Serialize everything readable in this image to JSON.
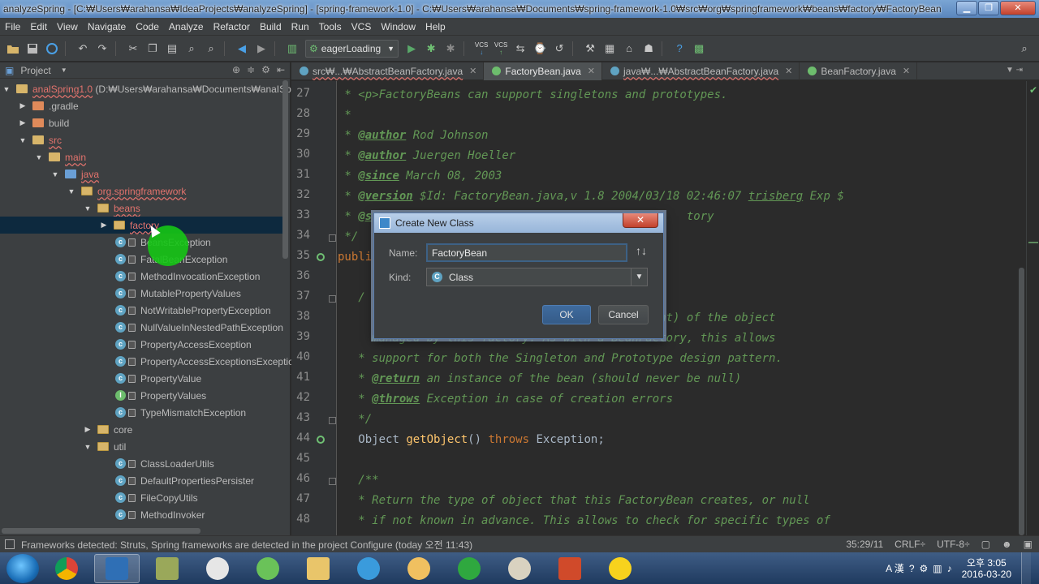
{
  "window": {
    "title": "analyzeSpring - [C:₩Users₩arahansa₩IdeaProjects₩analyzeSpring] - [spring-framework-1.0] - C:₩Users₩arahansa₩Documents₩spring-framework-1.0₩src₩org₩springframework₩beans₩factory₩FactoryBean.java...",
    "minimize": "▁",
    "maximize": "❐",
    "close": "✕"
  },
  "menu": [
    "File",
    "Edit",
    "View",
    "Navigate",
    "Code",
    "Analyze",
    "Refactor",
    "Build",
    "Run",
    "Tools",
    "VCS",
    "Window",
    "Help"
  ],
  "toolbar": {
    "run_config": "eagerLoading",
    "vcs1": "VCS",
    "vcs2": "VCS"
  },
  "project": {
    "header": "Project",
    "tree": [
      {
        "label": "analSpring1.0",
        "extra": "(D:₩Users₩arahansa₩Documents₩anaISpr",
        "type": "module",
        "expanded": true
      },
      {
        "label": ".gradle",
        "type": "folder",
        "expanded": false
      },
      {
        "label": "build",
        "type": "folder",
        "expanded": false
      },
      {
        "label": "src",
        "type": "folder",
        "expanded": true
      },
      {
        "label": "main",
        "type": "folder",
        "expanded": true
      },
      {
        "label": "java",
        "type": "src",
        "expanded": true
      },
      {
        "label": "org.springframework",
        "type": "pkg",
        "expanded": true
      },
      {
        "label": "beans",
        "type": "pkg",
        "expanded": true
      },
      {
        "label": "factory",
        "type": "pkg",
        "expanded": false
      },
      {
        "label": "BeansException",
        "type": "class"
      },
      {
        "label": "FatalBeanException",
        "type": "class"
      },
      {
        "label": "MethodInvocationException",
        "type": "class"
      },
      {
        "label": "MutablePropertyValues",
        "type": "class"
      },
      {
        "label": "NotWritablePropertyException",
        "type": "class"
      },
      {
        "label": "NullValueInNestedPathException",
        "type": "class"
      },
      {
        "label": "PropertyAccessException",
        "type": "class"
      },
      {
        "label": "PropertyAccessExceptionsException",
        "type": "class"
      },
      {
        "label": "PropertyValue",
        "type": "class"
      },
      {
        "label": "PropertyValues",
        "type": "interface"
      },
      {
        "label": "TypeMismatchException",
        "type": "class"
      },
      {
        "label": "core",
        "type": "pkg",
        "expanded": false
      },
      {
        "label": "util",
        "type": "pkg",
        "expanded": true
      },
      {
        "label": "ClassLoaderUtils",
        "type": "class"
      },
      {
        "label": "DefaultPropertiesPersister",
        "type": "class"
      },
      {
        "label": "FileCopyUtils",
        "type": "class"
      },
      {
        "label": "MethodInvoker",
        "type": "class"
      }
    ]
  },
  "tabs": [
    {
      "label": "src₩...₩AbstractBeanFactory.java",
      "active": false,
      "icon": "class"
    },
    {
      "label": "FactoryBean.java",
      "active": true,
      "icon": "interface"
    },
    {
      "label": "java₩...₩AbstractBeanFactory.java",
      "active": false,
      "icon": "class"
    },
    {
      "label": "BeanFactory.java",
      "active": false,
      "icon": "interface"
    }
  ],
  "tab_close": "✕",
  "editor": {
    "line_numbers": [
      "27",
      "28",
      "29",
      "30",
      "31",
      "32",
      "33",
      "34",
      "35",
      "36",
      "37",
      "38",
      "39",
      "40",
      "41",
      "42",
      "43",
      "44",
      "45",
      "46",
      "47",
      "48"
    ],
    "lines": {
      "l27": " * <p>FactoryBeans can support singletons and prototypes.",
      "l28": " *",
      "l29_tag": "@author",
      "l29_rest": " Rod Johnson",
      "l30_tag": "@author",
      "l30_rest": " Juergen Hoeller",
      "l31_tag": "@since",
      "l31_rest": " March 08, 2003",
      "l32_tag": "@version",
      "l32_rest": " $Id: FactoryBean.java,v 1.8 2004/03/18 02:46:07 ",
      "l32_user": "trisberg",
      "l32_end": " Exp $",
      "l33_tag": "@s",
      "l33_rest": "                                              tory",
      "l34": " */",
      "l35": "publi",
      "l37": "   /",
      "l38": "                                          pendent) of the object",
      "l39": "     managed by this factory. As with a BeanFactory, this allows",
      "l40": "   * support for both the Singleton and Prototype design pattern.",
      "l41_tag": "@return",
      "l41_rest": " an instance of the bean (should never be null)",
      "l42_tag": "@throws",
      "l42_rest": " Exception in case of creation errors",
      "l43": "   */",
      "l44_type": "Object",
      "l44_method": "getObject",
      "l44_paren": "()",
      "l44_throws": "throws",
      "l44_exc": "Exception;",
      "l46": "   /**",
      "l47": "   * Return the type of object that this FactoryBean creates, or null",
      "l48": "   * if not known in advance. This allows to check for specific types of"
    }
  },
  "dialog": {
    "title": "Create New Class",
    "name_label": "Name:",
    "name_value": "FactoryBean",
    "kind_label": "Kind:",
    "kind_value": "Class",
    "kind_icon": "C",
    "sort_icon": "↑↓",
    "dropdown_arrow": "▼",
    "ok": "OK",
    "cancel": "Cancel",
    "close": "✕"
  },
  "status": {
    "message": "Frameworks detected: Struts, Spring frameworks are detected in the project Configure (today 오전 11:43)",
    "position": "35:29/11",
    "line_sep": "CRLF÷",
    "encoding": "UTF-8÷"
  },
  "taskbar": {
    "time": "오후 3:05",
    "date": "2016-03-20",
    "lang": "A 漢"
  }
}
